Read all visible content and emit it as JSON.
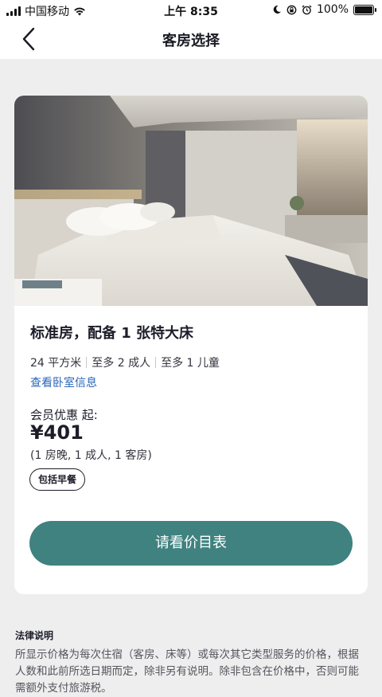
{
  "status_bar": {
    "carrier": "中国移动",
    "time": "上午 8:35",
    "battery": "100%"
  },
  "nav": {
    "title": "客房选择",
    "back_icon": "chevron-left-icon"
  },
  "room": {
    "name": "标准房，配备 1 张特大床",
    "specs": [
      "24 平方米",
      "至多 2 成人",
      "至多 1 儿童"
    ],
    "info_link": "查看卧室信息",
    "member_label": "会员优惠 起:",
    "price": "¥401",
    "price_detail": "(1 房晚, 1 成人, 1 客房)",
    "tag": "包括早餐",
    "cta_label": "请看价目表"
  },
  "legal": {
    "title": "法律说明",
    "body": "所显示价格为每次住宿（客房、床等）或每次其它类型服务的价格，根据人数和此前所选日期而定，除非另有说明。除非包含在价格中，否则可能需额外支付旅游税。"
  },
  "colors": {
    "accent": "#3f8280",
    "link": "#2a66b8",
    "background": "#eeeeee"
  }
}
